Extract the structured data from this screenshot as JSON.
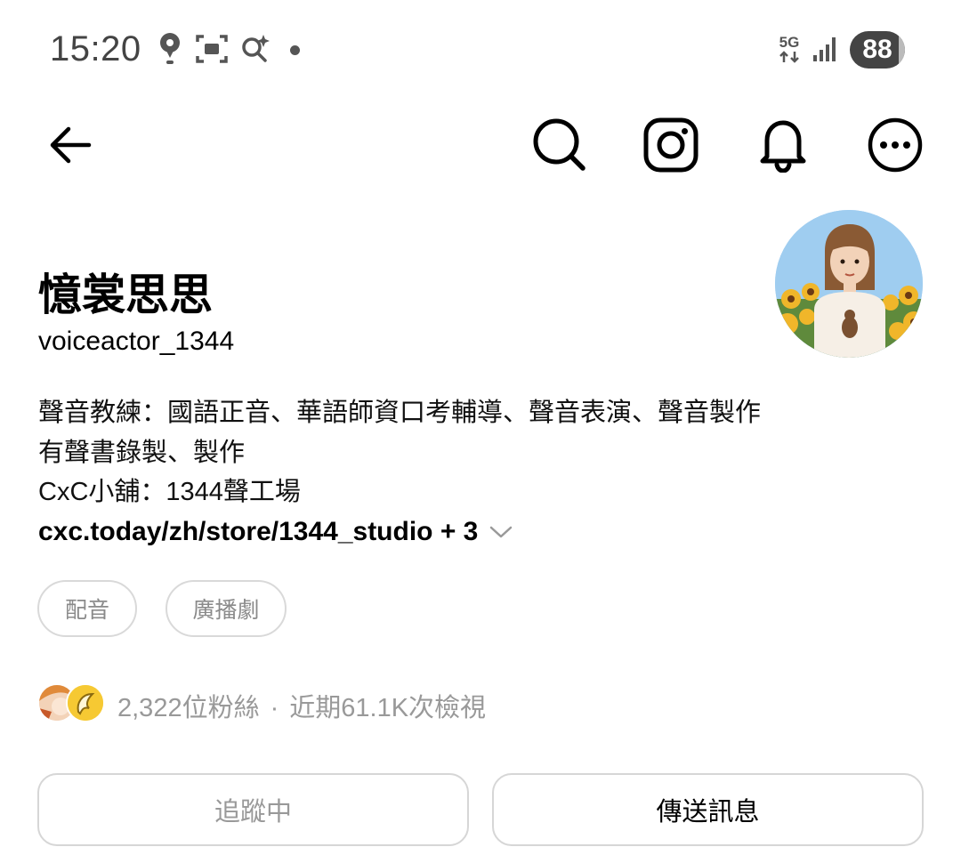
{
  "status_bar": {
    "time": "15:20",
    "network": "5G",
    "battery": "88",
    "icons": [
      "location-pin-icon",
      "screenshot-icon",
      "smart-search-icon",
      "notification-dot-icon",
      "signal-icon"
    ]
  },
  "nav": {
    "icons": [
      "back-arrow-icon",
      "search-icon",
      "instagram-icon",
      "bell-icon",
      "more-icon"
    ]
  },
  "profile": {
    "display_name": "憶裳思思",
    "username": "voiceactor_1344",
    "bio_lines": [
      "聲音教練：國語正音、華語師資口考輔導、聲音表演、聲音製作",
      "有聲書錄製、製作",
      "CxC小舖：1344聲工場"
    ],
    "link": "cxc.today/zh/store/1344_studio + 3"
  },
  "tags": [
    "配音",
    "廣播劇"
  ],
  "stats": {
    "followers": "2,322位粉絲",
    "separator": "·",
    "views": "近期61.1K次檢視"
  },
  "actions": {
    "following_label": "追蹤中",
    "message_label": "傳送訊息"
  },
  "colors": {
    "text_primary": "#000000",
    "text_secondary": "#999999",
    "border": "#d6d6d6"
  }
}
